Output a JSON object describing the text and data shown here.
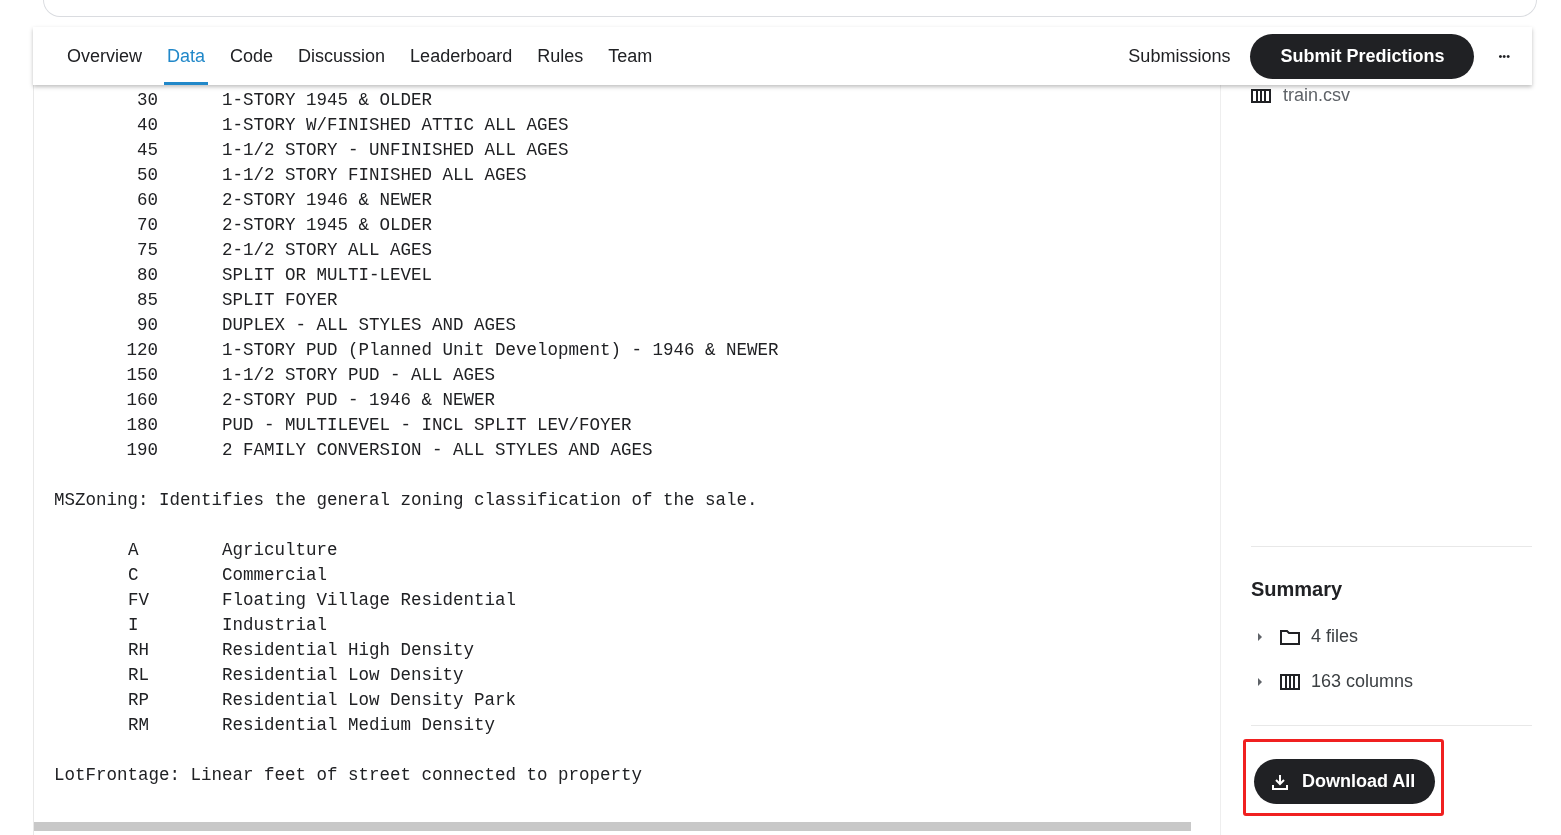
{
  "tabs": [
    {
      "label": "Overview",
      "selected": false
    },
    {
      "label": "Data",
      "selected": true
    },
    {
      "label": "Code",
      "selected": false
    },
    {
      "label": "Discussion",
      "selected": false
    },
    {
      "label": "Leaderboard",
      "selected": false
    },
    {
      "label": "Rules",
      "selected": false
    },
    {
      "label": "Team",
      "selected": false
    }
  ],
  "submissions_link": "Submissions",
  "submit_button": "Submit Predictions",
  "more_button": "•••",
  "description": [
    {
      "kind": "number_table",
      "rows": [
        {
          "code": "30",
          "text": "1-STORY 1945 & OLDER"
        },
        {
          "code": "40",
          "text": "1-STORY W/FINISHED ATTIC ALL AGES"
        },
        {
          "code": "45",
          "text": "1-1/2 STORY - UNFINISHED ALL AGES"
        },
        {
          "code": "50",
          "text": "1-1/2 STORY FINISHED ALL AGES"
        },
        {
          "code": "60",
          "text": "2-STORY 1946 & NEWER"
        },
        {
          "code": "70",
          "text": "2-STORY 1945 & OLDER"
        },
        {
          "code": "75",
          "text": "2-1/2 STORY ALL AGES"
        },
        {
          "code": "80",
          "text": "SPLIT OR MULTI-LEVEL"
        },
        {
          "code": "85",
          "text": "SPLIT FOYER"
        },
        {
          "code": "90",
          "text": "DUPLEX - ALL STYLES AND AGES"
        },
        {
          "code": "120",
          "text": "1-STORY PUD (Planned Unit Development) - 1946 & NEWER"
        },
        {
          "code": "150",
          "text": "1-1/2 STORY PUD - ALL AGES"
        },
        {
          "code": "160",
          "text": "2-STORY PUD - 1946 & NEWER"
        },
        {
          "code": "180",
          "text": "PUD - MULTILEVEL - INCL SPLIT LEV/FOYER"
        },
        {
          "code": "190",
          "text": "2 FAMILY CONVERSION - ALL STYLES AND AGES"
        }
      ]
    },
    {
      "kind": "field",
      "text": "MSZoning: Identifies the general zoning classification of the sale."
    },
    {
      "kind": "letter_table",
      "rows": [
        {
          "code": "A",
          "text": "Agriculture"
        },
        {
          "code": "C",
          "text": "Commercial"
        },
        {
          "code": "FV",
          "text": "Floating Village Residential"
        },
        {
          "code": "I",
          "text": "Industrial"
        },
        {
          "code": "RH",
          "text": "Residential High Density"
        },
        {
          "code": "RL",
          "text": "Residential Low Density"
        },
        {
          "code": "RP",
          "text": "Residential Low Density Park"
        },
        {
          "code": "RM",
          "text": "Residential Medium Density"
        }
      ]
    },
    {
      "kind": "field",
      "text": "LotFrontage: Linear feet of street connected to property"
    }
  ],
  "sidebar": {
    "file": "train.csv",
    "summary": {
      "title": "Summary",
      "items": [
        {
          "kind": "files",
          "label": "4 files",
          "expanded": false
        },
        {
          "kind": "columns",
          "label": "163 columns",
          "expanded": false
        }
      ]
    },
    "download_button": {
      "label": "Download All",
      "highlighted": true
    }
  }
}
